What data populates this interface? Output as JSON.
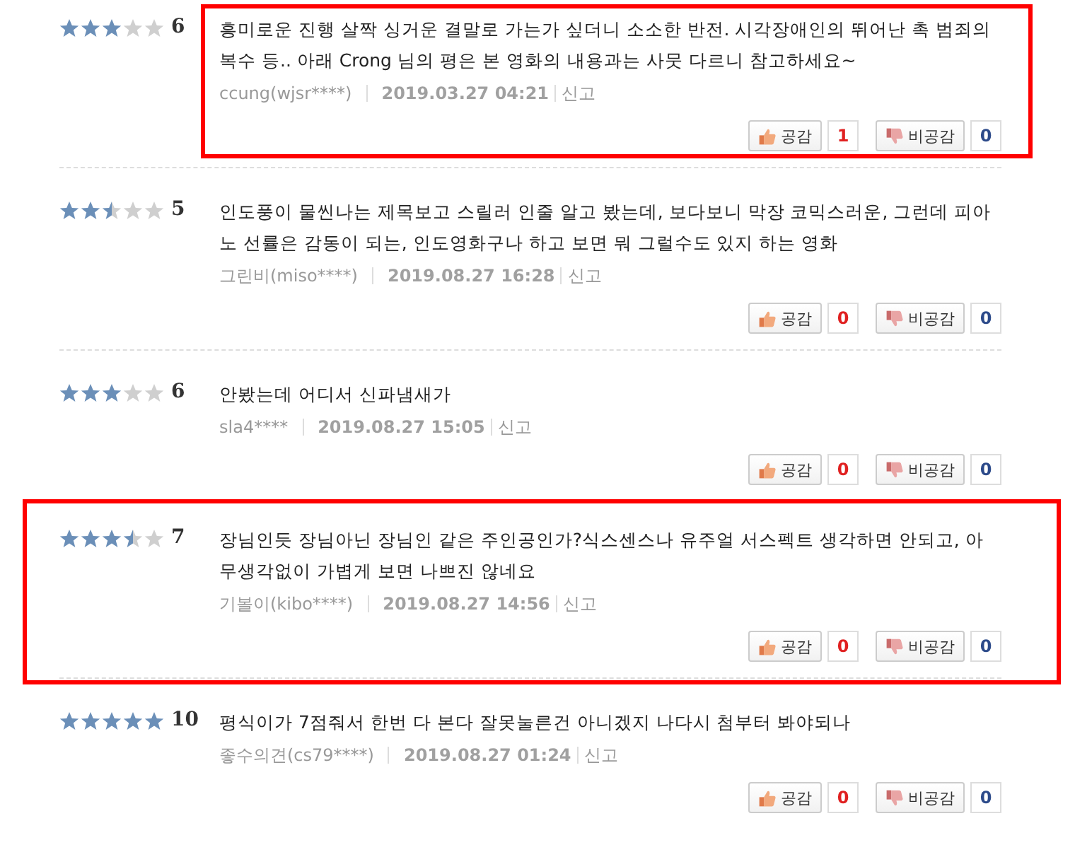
{
  "reviews": [
    {
      "stars": 3,
      "score": "6",
      "text": "흥미로운 진행 살짝 싱거운 결말로 가는가 싶더니 소소한 반전. 시각장애인의 뛰어난 촉 범죄의 복수 등.. 아래 Crong 님의 평은 본 영화의 내용과는 사뭇 다르니 참고하세요~",
      "author": "ccung(wjsr****)",
      "date": "2019.03.27 04:21",
      "report": "신고",
      "like_label": "공감",
      "likes": "1",
      "dislike_label": "비공감",
      "dislikes": "0",
      "highlight_content": true,
      "highlight_row": false
    },
    {
      "stars": 2.5,
      "score": "5",
      "text": "인도풍이 물씬나는 제목보고 스릴러 인줄 알고 봤는데, 보다보니 막장 코믹스러운, 그런데 피아노 선률은 감동이 되는, 인도영화구나 하고 보면 뭐 그럴수도 있지 하는 영화",
      "author": "그린비(miso****)",
      "date": "2019.08.27 16:28",
      "report": "신고",
      "like_label": "공감",
      "likes": "0",
      "dislike_label": "비공감",
      "dislikes": "0",
      "highlight_content": false,
      "highlight_row": false
    },
    {
      "stars": 3,
      "score": "6",
      "text": "안봤는데 어디서 신파냄새가",
      "author": "sla4****",
      "date": "2019.08.27 15:05",
      "report": "신고",
      "like_label": "공감",
      "likes": "0",
      "dislike_label": "비공감",
      "dislikes": "0",
      "highlight_content": false,
      "highlight_row": false
    },
    {
      "stars": 3.5,
      "score": "7",
      "text": "장님인듯 장님아닌 장님인 같은 주인공인가?식스센스나 유주얼 서스펙트 생각하면 안되고, 아무생각없이 가볍게 보면 나쁘진 않네요",
      "author": "기볼이(kibo****)",
      "date": "2019.08.27 14:56",
      "report": "신고",
      "like_label": "공감",
      "likes": "0",
      "dislike_label": "비공감",
      "dislikes": "0",
      "highlight_content": false,
      "highlight_row": true
    },
    {
      "stars": 5,
      "score": "10",
      "text": "평식이가 7점줘서 한번 다 본다 잘못눌른건 아니겠지 나다시 첨부터 봐야되나",
      "author": "좋수의견(cs79****)",
      "date": "2019.08.27 01:24",
      "report": "신고",
      "like_label": "공감",
      "likes": "0",
      "dislike_label": "비공감",
      "dislikes": "0",
      "highlight_content": false,
      "highlight_row": false
    }
  ]
}
